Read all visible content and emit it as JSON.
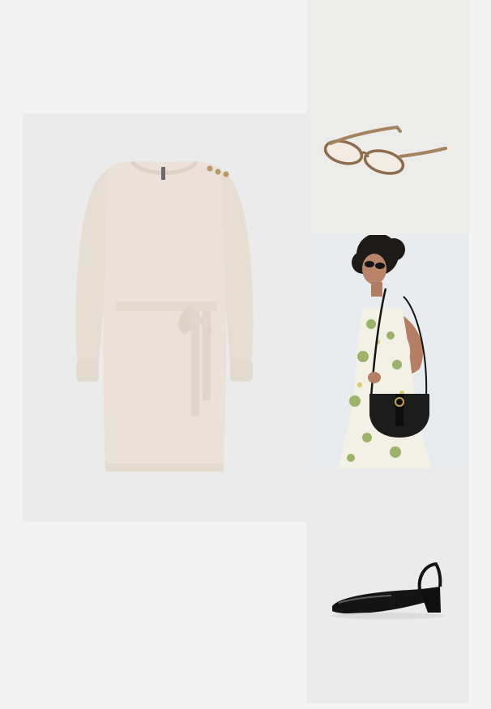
{
  "collage": {
    "items": [
      {
        "id": "dress",
        "alt": "Beige knit sweater dress with tie belt"
      },
      {
        "id": "glasses",
        "alt": "Brown oval frame glasses"
      },
      {
        "id": "model",
        "alt": "Model wearing floral slip dress with black crossbody saddle bag"
      },
      {
        "id": "shoe",
        "alt": "Black patent slingback block heel pump"
      }
    ]
  },
  "colors": {
    "page_bg": "#f3f3f3",
    "tile_bg": "#ebebeb",
    "dress": "#e9e1d8",
    "glasses_frame": "#9b7a5a",
    "bag": "#1c1c1c",
    "shoe": "#141414",
    "floral_green": "#9bb36a"
  }
}
